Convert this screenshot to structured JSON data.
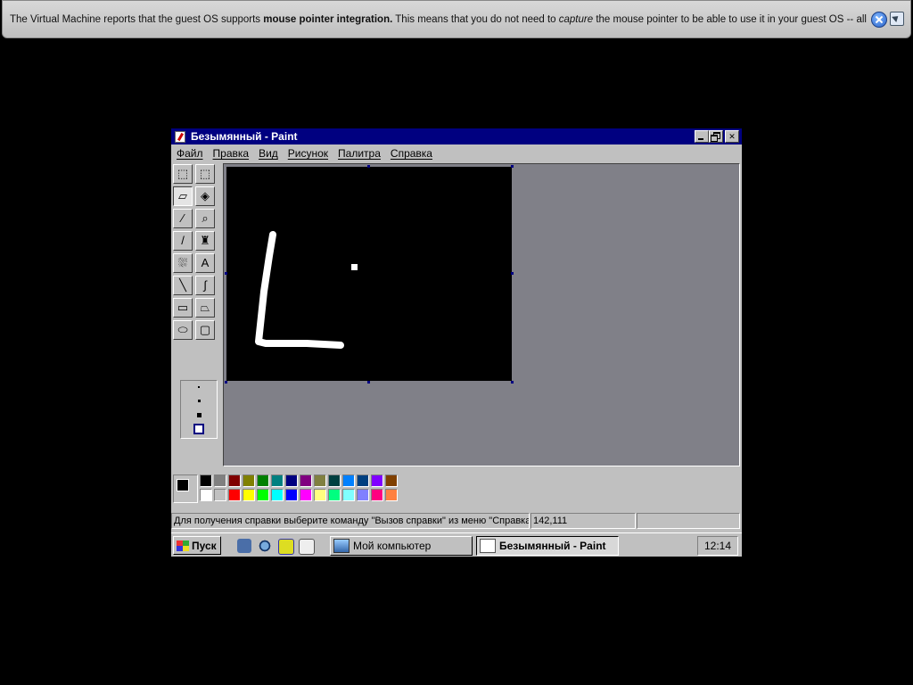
{
  "vm_notification": {
    "text_part1": "The Virtual Machine reports that the guest OS supports ",
    "text_bold": "mouse pointer integration.",
    "text_part2": " This means that you do not need to ",
    "text_italic": "capture",
    "text_part3": " the mouse pointer to be able to use it in your guest OS -- all mouse"
  },
  "window": {
    "title": "Безымянный - Paint",
    "menu": [
      "Файл",
      "Правка",
      "Вид",
      "Рисунок",
      "Палитра",
      "Справка"
    ]
  },
  "tools": [
    {
      "name": "free-select-icon",
      "glyph": "⬚"
    },
    {
      "name": "rect-select-icon",
      "glyph": "⬚"
    },
    {
      "name": "eraser-icon",
      "glyph": "▱"
    },
    {
      "name": "fill-bucket-icon",
      "glyph": "◈"
    },
    {
      "name": "color-picker-icon",
      "glyph": "⁄"
    },
    {
      "name": "magnifier-icon",
      "glyph": "⌕"
    },
    {
      "name": "pencil-icon",
      "glyph": "/"
    },
    {
      "name": "brush-icon",
      "glyph": "♜"
    },
    {
      "name": "airbrush-icon",
      "glyph": "⛆"
    },
    {
      "name": "text-icon",
      "glyph": "A"
    },
    {
      "name": "line-icon",
      "glyph": "╲"
    },
    {
      "name": "curve-icon",
      "glyph": "∫"
    },
    {
      "name": "rectangle-icon",
      "glyph": "▭"
    },
    {
      "name": "polygon-icon",
      "glyph": "⏢"
    },
    {
      "name": "ellipse-icon",
      "glyph": "⬭"
    },
    {
      "name": "rounded-rect-icon",
      "glyph": "▢"
    }
  ],
  "selected_tool": "eraser-icon",
  "palette": {
    "top": [
      "#000000",
      "#808080",
      "#800000",
      "#808000",
      "#008000",
      "#008080",
      "#000080",
      "#800080",
      "#808040",
      "#004040",
      "#0080ff",
      "#004080",
      "#8000ff",
      "#804000"
    ],
    "bottom": [
      "#ffffff",
      "#c0c0c0",
      "#ff0000",
      "#ffff00",
      "#00ff00",
      "#00ffff",
      "#0000ff",
      "#ff00ff",
      "#ffff80",
      "#00ff80",
      "#80ffff",
      "#8080ff",
      "#ff0080",
      "#ff8040"
    ],
    "foreground": "#000000",
    "background": "#ffffff"
  },
  "status": {
    "help": "Для получения справки выберите команду \"Вызов справки\" из меню \"Справка\".",
    "coords": "142,111",
    "size": ""
  },
  "taskbar": {
    "start": "Пуск",
    "quick_launch": [
      "desktop-icon",
      "ie-browser-icon",
      "outlook-icon",
      "channels-icon"
    ],
    "tasks": [
      {
        "label": "Мой компьютер",
        "active": false
      },
      {
        "label": "Безымянный - Paint",
        "active": true
      }
    ],
    "clock": "12:14"
  }
}
